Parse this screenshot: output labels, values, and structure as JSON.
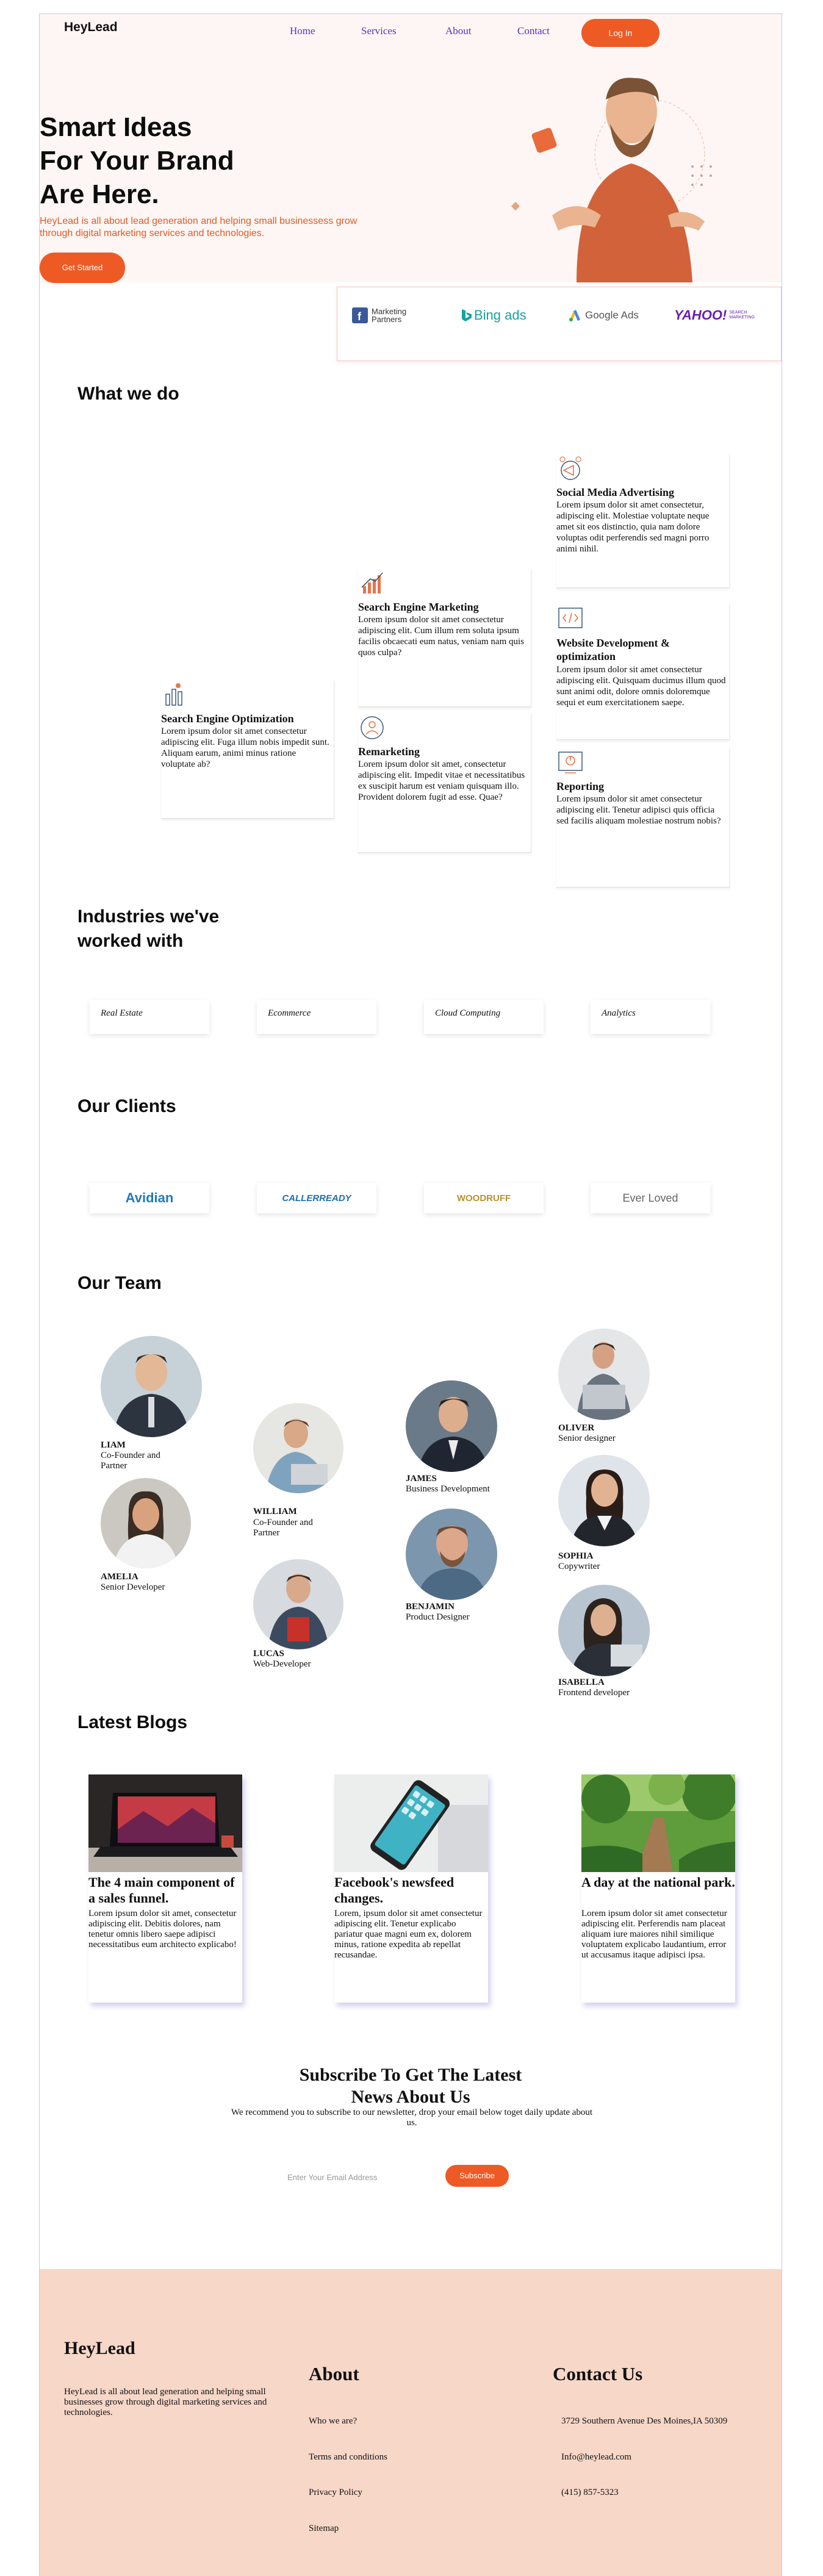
{
  "header": {
    "logo": "HeyLead",
    "nav": [
      "Home",
      "Services",
      "About",
      "Contact"
    ],
    "login_label": "Log In"
  },
  "hero": {
    "title_lines": [
      "Smart Ideas",
      "For Your Brand",
      "Are Here."
    ],
    "subtitle": "HeyLead is all about lead generation and helping small businessess grow through digital marketing services and technologies.",
    "cta": "Get Started"
  },
  "partners": [
    {
      "text": "Marketing Partners",
      "icon": "facebook-icon"
    },
    {
      "text": "Bing ads",
      "icon": "bing-icon"
    },
    {
      "text": "Google Ads",
      "icon": "google-ads-icon"
    },
    {
      "text": "YAHOO!",
      "sub": "SEARCH MARKETING",
      "icon": "yahoo-icon"
    }
  ],
  "services": {
    "heading": "What we do",
    "items": [
      {
        "title": "Search Engine Optimization",
        "desc": "Lorem ipsum dolor sit amet consectetur adipiscing elit. Fuga illum nobis impedit sunt. Aliquam earum, animi minus ratione voluptate ab?",
        "icon": "analytics-icon"
      },
      {
        "title": "Search Engine Marketing",
        "desc": "Lorem ipsum dolor sit amet consectetur adipiscing elit. Cum illum rem soluta ipsum facilis obcaecati eum natus, veniam nam quis quos culpa?",
        "icon": "growth-chart-icon"
      },
      {
        "title": "Remarketing",
        "desc": "Lorem ipsum dolor sit amet, consectetur adipiscing elit. Impedit vitae et necessitatibus ex suscipit harum est veniam quisquam illo. Provident dolorem fugit ad esse. Quae?",
        "icon": "target-person-icon"
      },
      {
        "title": "Social Media Advertising",
        "desc": "Lorem ipsum dolor sit amet consectetur, adipiscing elit. Molestiae voluptate neque amet sit eos distinctio, quia nam dolore voluptas odit perferendis sed magni porro animi nihil.",
        "icon": "megaphone-icon"
      },
      {
        "title": "Website Development & optimization",
        "desc": "Lorem ipsum dolor sit amet consectetur adipiscing elit. Quisquam ducimus illum quod sunt animi odit, dolore omnis doloremque sequi et eum exercitationem saepe.",
        "icon": "code-icon"
      },
      {
        "title": "Reporting",
        "desc": "Lorem ipsum dolor sit amet consectetur adipiscing elit. Tenetur adipisci quis officia sed facilis aliquam molestiae nostrum nobis?",
        "icon": "report-icon"
      }
    ]
  },
  "industries": {
    "heading_lines": [
      "Industries we've",
      "worked with"
    ],
    "items": [
      "Real Estate",
      "Ecommerce",
      "Cloud Computing",
      "Analytics"
    ]
  },
  "clients": {
    "heading": "Our Clients",
    "items": [
      "Avidian",
      "CALLERREADY",
      "WOODRUFF",
      "Ever Loved"
    ]
  },
  "team": {
    "heading": "Our Team",
    "members": [
      {
        "name": "LIAM",
        "role": "Co-Founder and Partner"
      },
      {
        "name": "AMELIA",
        "role": "Senior Developer"
      },
      {
        "name": "WILLIAM",
        "role": "Co-Founder and Partner"
      },
      {
        "name": "LUCAS",
        "role": "Web-Developer"
      },
      {
        "name": "JAMES",
        "role": "Business Development"
      },
      {
        "name": "BENJAMIN",
        "role": "Product Designer"
      },
      {
        "name": "OLIVER",
        "role": "Senior designer"
      },
      {
        "name": "SOPHIA",
        "role": "Copywriter"
      },
      {
        "name": "ISABELLA",
        "role": "Frontend developer"
      }
    ]
  },
  "blogs": {
    "heading": "Latest Blogs",
    "items": [
      {
        "title": "The 4 main component of a sales funnel.",
        "desc": "Lorem ipsum dolor sit amet, consectetur adipiscing elit. Debitis dolores, nam tenetur omnis libero saepe adipisci necessitatibus eum architecto explicabo!"
      },
      {
        "title": "Facebook's newsfeed changes.",
        "desc": "Lorem, ipsum dolor sit amet consectetur adipiscing elit. Tenetur explicabo pariatur quae magni eum ex, dolorem minus, ratione expedita ab repellat recusandae."
      },
      {
        "title": "A day at the national park.",
        "desc": "Lorem ipsum dolor sit amet consectetur adipiscing elit. Perferendis nam placeat aliquam iure maiores nihil similique voluptatem explicabo laudantium, error ut accusamus itaque adipisci ipsa."
      }
    ]
  },
  "subscribe": {
    "title_lines": [
      "Subscribe To Get The Latest",
      "News About Us"
    ],
    "desc": "We recommend you to subscribe to our newsletter, drop your email below toget daily update about us.",
    "placeholder": "Enter Your Email Address",
    "button": "Subscribe"
  },
  "footer": {
    "logo": "HeyLead",
    "desc": "HeyLead is all about lead generation and helping small businesses grow through digital marketing services and technologies.",
    "about_heading": "About",
    "about_links": [
      "Who we are?",
      "Terms and conditions",
      "Privacy Policy",
      "Sitemap"
    ],
    "contact_heading": "Contact Us",
    "contact": [
      "3729 Southern Avenue Des Moines,IA 50309",
      "Info@heylead.com",
      "(415) 857-5323"
    ]
  },
  "colors": {
    "accent": "#ee5a24",
    "nav": "#5a2fc2",
    "footer_bg": "#f7d7c8",
    "hero_bg": "#fdf6f4"
  }
}
